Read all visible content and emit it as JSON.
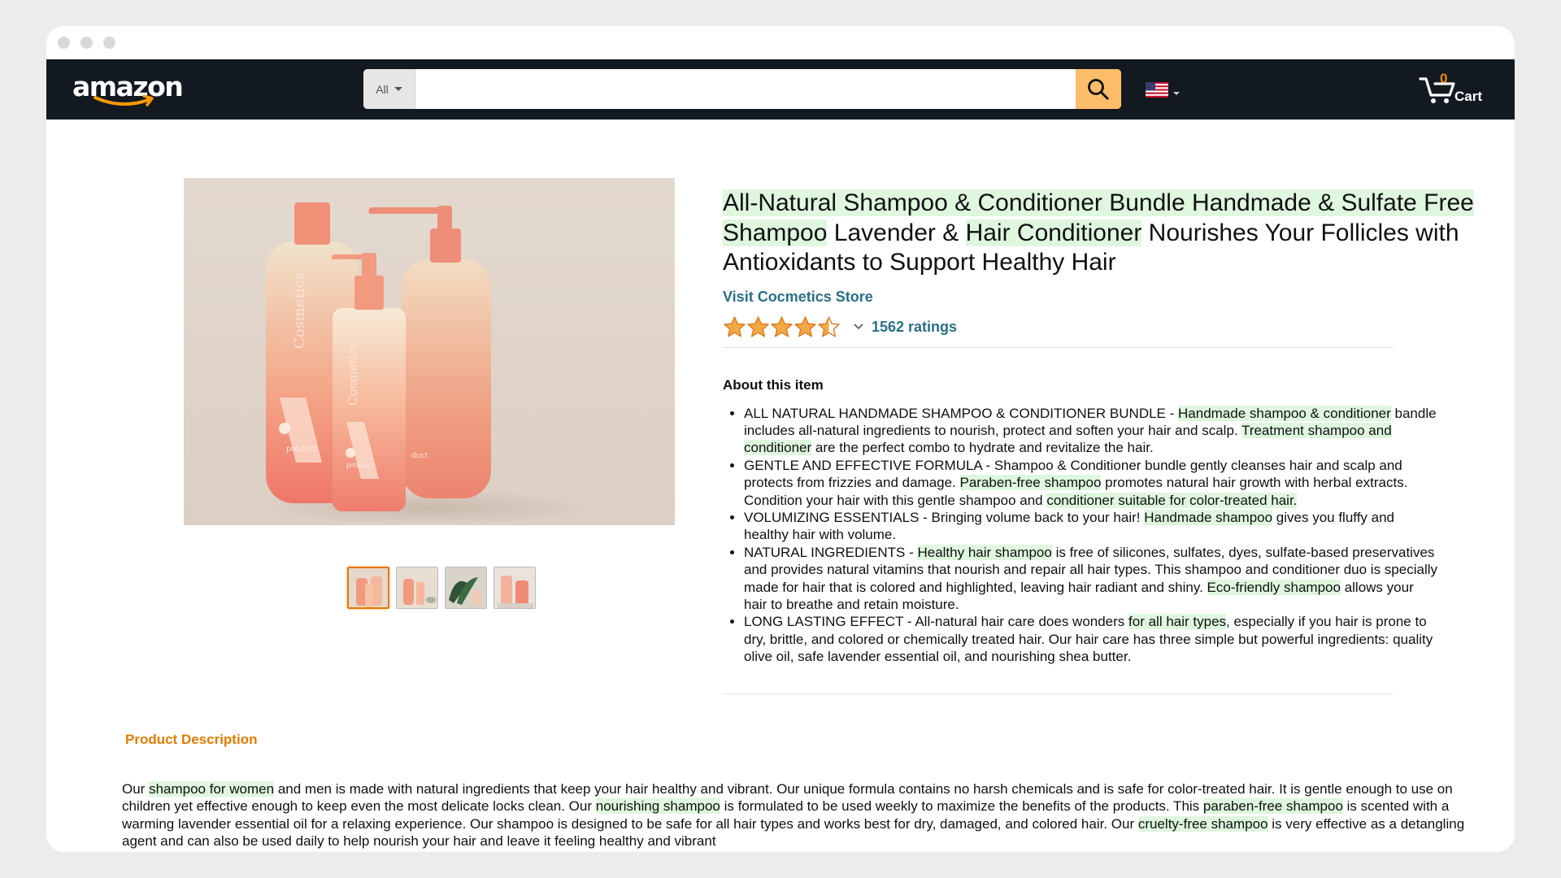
{
  "header": {
    "logo_text": "amazon",
    "search_category": "All",
    "search_value": "",
    "search_placeholder": "",
    "cart_count": "0",
    "cart_label": "Cart",
    "flag_icon": "us-flag-icon"
  },
  "gallery": {
    "main_image_icon": "product-photo-bottles",
    "thumbnails": [
      "thumb-1",
      "thumb-2",
      "thumb-3",
      "thumb-4"
    ],
    "active_thumbnail": 1
  },
  "product": {
    "title_segments": [
      {
        "text": "All-Natural Shampoo & Conditioner Bundle ",
        "highlight": true
      },
      {
        "text": "Handmade & Sulfate Free Shampoo",
        "highlight": true
      },
      {
        "text": " Lavender & ",
        "highlight": false
      },
      {
        "text": "Hair Conditioner",
        "highlight": true
      },
      {
        "text": " Nourishes Your Follicles with Antioxidants to Support Healthy Hair",
        "highlight": false
      }
    ],
    "store_link": "Visit Cocmetics Store",
    "rating_stars": 4.5,
    "ratings_count": "1562 ratings"
  },
  "about": {
    "heading": "About this item",
    "bullets": [
      [
        {
          "text": "ALL NATURAL HANDMADE SHAMPOO & CONDITIONER BUNDLE - ",
          "highlight": false
        },
        {
          "text": "Handmade shampoo & conditioner",
          "highlight": true
        },
        {
          "text": " bandle includes all-natural ingredients to nourish, protect and soften your hair and scalp. ",
          "highlight": false
        },
        {
          "text": "Treatment shampoo and conditioner",
          "highlight": true
        },
        {
          "text": " are the perfect combo to hydrate and revitalize the hair.",
          "highlight": false
        }
      ],
      [
        {
          "text": "GENTLE AND EFFECTIVE FORMULA - Shampoo & Conditioner bundle gently cleanses hair and scalp and protects from frizzies and damage. ",
          "highlight": false
        },
        {
          "text": "Paraben-free shampoo",
          "highlight": true
        },
        {
          "text": " promotes natural hair growth with herbal extracts. Condition your hair with this gentle shampoo and ",
          "highlight": false
        },
        {
          "text": "conditioner suitable for color-treated hair.",
          "highlight": true
        }
      ],
      [
        {
          "text": "VOLUMIZING ESSENTIALS - Bringing volume back to your hair! ",
          "highlight": false
        },
        {
          "text": "Handmade shampoo",
          "highlight": true
        },
        {
          "text": " gives you fluffy and healthy hair with volume.",
          "highlight": false
        }
      ],
      [
        {
          "text": "NATURAL INGREDIENTS - ",
          "highlight": false
        },
        {
          "text": "Healthy hair shampoo",
          "highlight": true
        },
        {
          "text": " is free of silicones, sulfates, dyes, sulfate-based preservatives and provides natural vitamins that nourish and repair all hair types. This shampoo and conditioner duo is specially made for hair that is colored and highlighted, leaving hair radiant and shiny. ",
          "highlight": false
        },
        {
          "text": "Eco-friendly shampoo",
          "highlight": true
        },
        {
          "text": " allows your hair to breathe and retain moisture.",
          "highlight": false
        }
      ],
      [
        {
          "text": "LONG LASTING EFFECT - All-natural hair care does wonders ",
          "highlight": false
        },
        {
          "text": "for all hair types",
          "highlight": true
        },
        {
          "text": ", especially if you hair is prone to dry, brittle, and colored or chemically treated hair. Our hair care has three simple but powerful ingredients: quality olive oil, safe lavender essential oil, and nourishing shea butter.",
          "highlight": false
        }
      ]
    ]
  },
  "description": {
    "heading": "Product Description",
    "segments": [
      {
        "text": "Our ",
        "highlight": false
      },
      {
        "text": "shampoo for women",
        "highlight": true
      },
      {
        "text": " and men is made with natural ingredients that keep your hair healthy and vibrant. Our unique formula contains no harsh chemicals and is safe for color-treated hair. It is gentle enough to use on children yet effective enough to keep even the most delicate locks clean. Our ",
        "highlight": false
      },
      {
        "text": "nourishing shampoo",
        "highlight": true
      },
      {
        "text": " is formulated to be used weekly to maximize the benefits of the products. This ",
        "highlight": false
      },
      {
        "text": "paraben-free shampoo",
        "highlight": true
      },
      {
        "text": " is scented with a warming lavender essential oil for a relaxing experience. Our shampoo is designed to be safe for all hair types and works best for dry, damaged, and colored hair. Our ",
        "highlight": false
      },
      {
        "text": "cruelty-free shampoo",
        "highlight": true
      },
      {
        "text": " is very effective as a detangling agent and can also be used daily to help nourish your hair and leave it feeling healthy and vibrant",
        "highlight": false
      }
    ]
  },
  "colors": {
    "nav_bg": "#131921",
    "search_button": "#febd69",
    "link": "#2b6f84",
    "highlight": "#def7de",
    "star": "#f3a847",
    "accent_orange": "#e07b00"
  }
}
